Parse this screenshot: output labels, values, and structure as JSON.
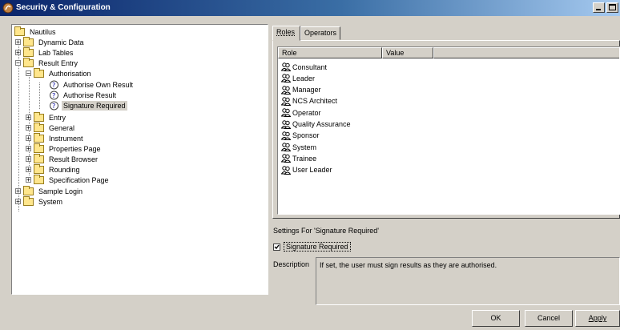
{
  "window": {
    "title": "Security & Configuration"
  },
  "tree": {
    "items": [
      {
        "label": "Nautilus"
      },
      {
        "label": "Dynamic Data"
      },
      {
        "label": "Lab Tables"
      },
      {
        "label": "Result Entry"
      },
      {
        "label": "Authorisation"
      },
      {
        "label": "Authorise Own Result"
      },
      {
        "label": "Authorise Result"
      },
      {
        "label": "Signature Required"
      },
      {
        "label": "Entry"
      },
      {
        "label": "General"
      },
      {
        "label": "Instrument"
      },
      {
        "label": "Properties Page"
      },
      {
        "label": "Result Browser"
      },
      {
        "label": "Rounding"
      },
      {
        "label": "Specification Page"
      },
      {
        "label": "Sample Login"
      },
      {
        "label": "System"
      }
    ]
  },
  "tabs": [
    {
      "label": "Roles"
    },
    {
      "label": "Operators"
    }
  ],
  "roles_list": {
    "columns": [
      "Role",
      "Value"
    ],
    "rows": [
      "Consultant",
      "Leader",
      "Manager",
      "NCS Architect",
      "Operator",
      "Quality Assurance",
      "Sponsor",
      "System",
      "Trainee",
      "User Leader"
    ]
  },
  "settings": {
    "title": "Settings For 'Signature Required'",
    "checkbox_label": "Signature Required",
    "checkbox_checked": true,
    "description_label": "Description",
    "description_text": "If set, the user must sign results as they are authorised."
  },
  "buttons": {
    "ok": "OK",
    "cancel": "Cancel",
    "apply": "Apply"
  }
}
